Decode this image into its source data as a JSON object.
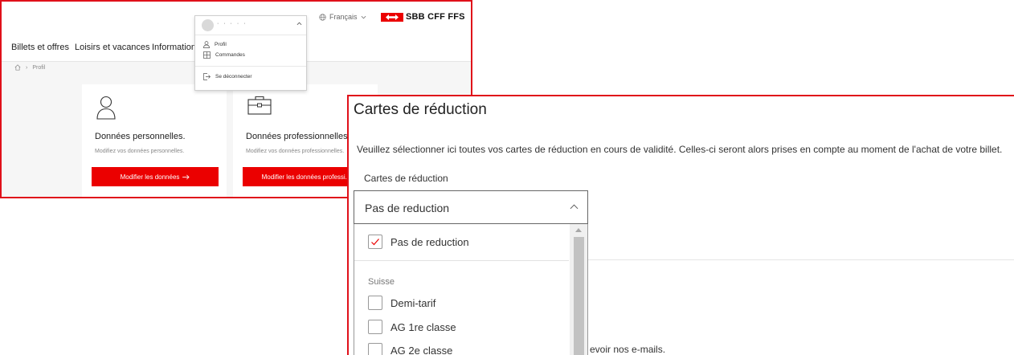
{
  "profile_page": {
    "lang": "Français",
    "logo_text": "SBB CFF FFS",
    "nav": [
      "Billets et offres",
      "Loisirs et vacances",
      "Informations"
    ],
    "breadcrumb": {
      "current": "Profil"
    },
    "user_menu": {
      "name": "·  ·  ·  ·  ·",
      "items": [
        "Profil",
        "Commandes"
      ],
      "logout": "Se déconnecter"
    },
    "cards": [
      {
        "title": "Données personnelles.",
        "subtitle": "Modifiez vos données personnelles.",
        "button": "Modifier les données"
      },
      {
        "title": "Données professionnelles.",
        "subtitle": "Modifiez vos données professionnelles.",
        "button": "Modifier les données professi..."
      }
    ]
  },
  "reductions": {
    "title": "Cartes de réduction",
    "description": "Veuillez sélectionner ici toutes vos cartes de réduction en cours de validité. Celles-ci seront alors prises en compte au moment de l'achat de votre billet.",
    "field_label": "Cartes de réduction",
    "selected": "Pas de reduction",
    "options": {
      "none": {
        "label": "Pas de reduction",
        "checked": true
      },
      "group": "Suisse",
      "swiss": [
        {
          "label": "Demi-tarif",
          "checked": false
        },
        {
          "label": "AG 1re classe",
          "checked": false
        },
        {
          "label": "AG 2e classe",
          "checked": false
        }
      ]
    },
    "email_text_fragment": "evoir nos e-mails."
  },
  "colors": {
    "accent": "#eb0000",
    "highlight_border": "#e0101a"
  },
  "icons": [
    "home-icon",
    "user-icon",
    "briefcase-icon",
    "chevron-up-icon",
    "chevron-down-icon",
    "globe-icon",
    "arrow-right-icon",
    "logout-icon",
    "orders-icon",
    "checkmark-icon"
  ]
}
